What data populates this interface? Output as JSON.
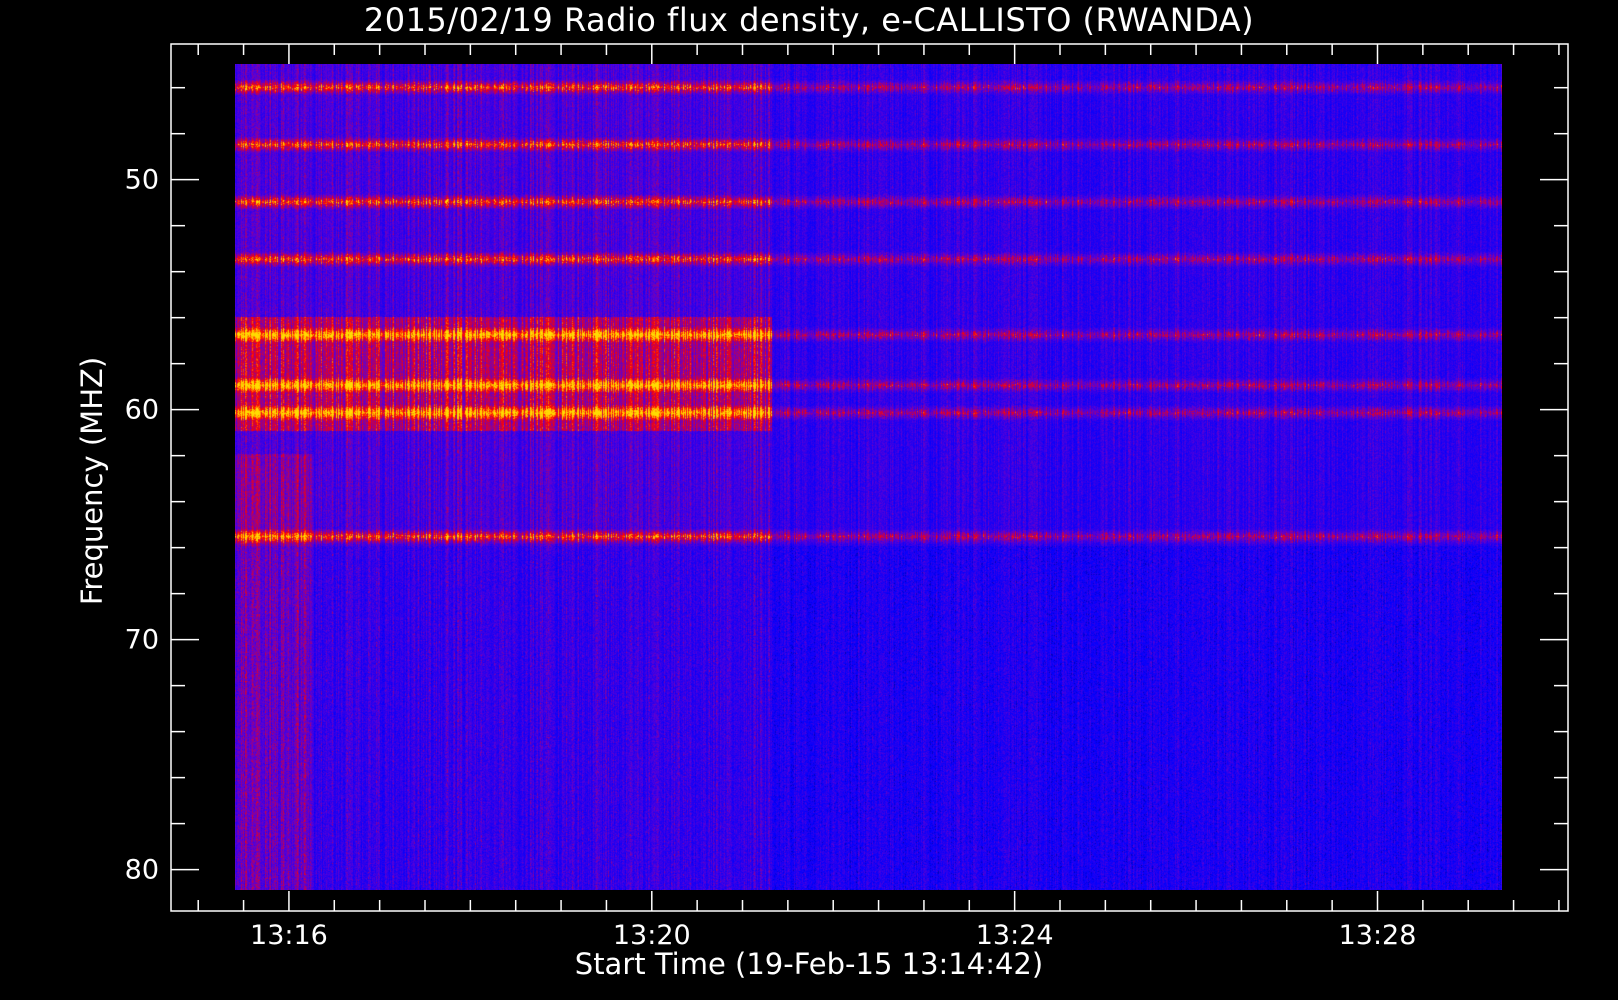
{
  "chart_data": {
    "type": "heatmap",
    "title": "2015/02/19  Radio flux density, e-CALLISTO (RWANDA)",
    "xlabel": "Start Time (19-Feb-15 13:14:42)",
    "ylabel": "Frequency (MHZ)",
    "x_ticks": [
      "13:16",
      "13:20",
      "13:24",
      "13:28"
    ],
    "x_tick_values_min": [
      16,
      20,
      24,
      28
    ],
    "x_range_min": [
      14.7,
      30.1
    ],
    "x_data_range_min": [
      15.47,
      30.42
    ],
    "y_ticks": [
      50,
      60,
      70,
      80
    ],
    "y_range": [
      44.1,
      81.8
    ],
    "y_data_range": [
      45.0,
      81.0
    ],
    "y_inverted": true,
    "colormap": [
      "#000000",
      "#0000ff",
      "#ff0000",
      "#ffff00"
    ],
    "bright_bands_mhz": [
      46.0,
      48.5,
      51.0,
      53.5,
      56.8,
      59.0,
      60.2,
      65.6
    ],
    "intense_region": {
      "time_min": [
        15.47,
        21.8
      ],
      "freq_mhz": [
        56.0,
        61.0
      ]
    }
  }
}
